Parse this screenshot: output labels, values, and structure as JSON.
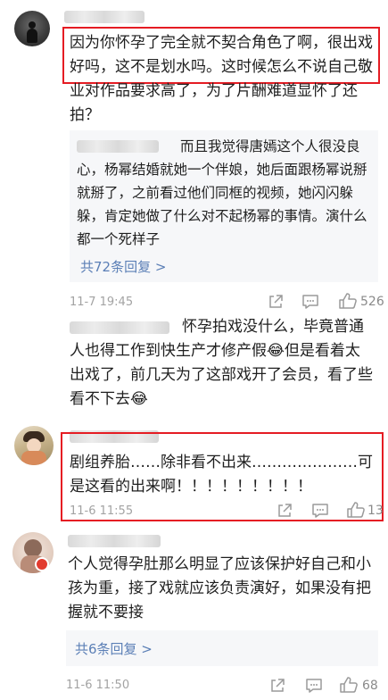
{
  "comments": [
    {
      "text": "因为你怀孕了完全就不契合角色了啊，很出戏好吗，这不是划水吗。这时候怎么不说自己敬业对作品要求高了，为了片酬难道显怀了还拍？",
      "reply_preview": {
        "text": "而且我觉得唐嫣这个人很没良心，杨幂结婚就她一个伴娘，她后面跟杨幂说掰就掰了，之前看过他们同框的视频，她闪闪躲躲，肯定她做了什么对不起杨幂的事情。演什么都一个死样子",
        "more_label": "共72条回复 >"
      },
      "time": "11-7 19:45",
      "like_count": "526"
    },
    {
      "text": "怀孕拍戏没什么，毕竟普通人也得工作到快生产才修产假😂但是看着太出戏了，前几天为了这部戏开了会员，看了些看不下去😂"
    },
    {
      "text": "剧组养胎……除非看不出来…………………可是这看的出来啊！！！！！！！！！",
      "time": "11-6 11:55",
      "like_count": "13"
    },
    {
      "text": "个人觉得孕肚那么明显了应该保护好自己和小孩为重，接了戏就应该负责演好，如果没有把握就不要接",
      "reply_preview": {
        "more_label": "共6条回复 >"
      },
      "time": "11-6 11:50",
      "like_count": "68"
    }
  ],
  "icons": [
    "share-icon",
    "comment-icon",
    "like-icon"
  ],
  "colors": {
    "highlight": "#e51c23",
    "link": "#5b7fb6",
    "meta": "#a3a3a3",
    "reply_bg": "#f6f7f9"
  }
}
